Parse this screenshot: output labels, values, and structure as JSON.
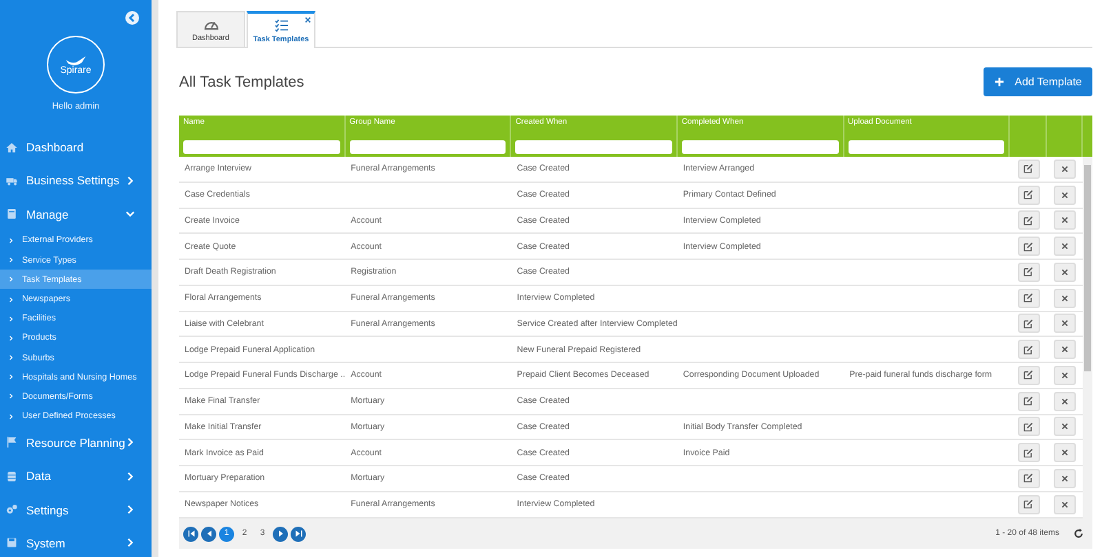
{
  "sidebar": {
    "logo": "Spirare",
    "greeting": "Hello admin",
    "items": [
      {
        "label": "Dashboard"
      },
      {
        "label": "Business Settings",
        "expanded": false
      },
      {
        "label": "Manage",
        "expanded": true,
        "children": [
          {
            "label": "External Providers",
            "selected": false
          },
          {
            "label": "Service Types",
            "selected": false
          },
          {
            "label": "Task Templates",
            "selected": true
          },
          {
            "label": "Newspapers",
            "selected": false
          },
          {
            "label": "Facilities",
            "selected": false
          },
          {
            "label": "Products",
            "selected": false
          },
          {
            "label": "Suburbs",
            "selected": false
          },
          {
            "label": "Hospitals and Nursing Homes",
            "selected": false
          },
          {
            "label": "Documents/Forms",
            "selected": false
          },
          {
            "label": "User Defined Processes",
            "selected": false
          }
        ]
      },
      {
        "label": "Resource Planning",
        "expanded": false
      },
      {
        "label": "Data",
        "expanded": false
      },
      {
        "label": "Settings",
        "expanded": false
      },
      {
        "label": "System",
        "expanded": false
      }
    ]
  },
  "tabs": [
    {
      "label": "Dashboard",
      "selected": false
    },
    {
      "label": "Task Templates",
      "selected": true
    }
  ],
  "page_title": "All Task Templates",
  "add_button": "Add Template",
  "table": {
    "columns": [
      "Name",
      "Group Name",
      "Created When",
      "Completed When",
      "Upload Document"
    ],
    "rows": [
      {
        "name": "Arrange Interview",
        "group": "Funeral Arrangements",
        "created": "Case Created",
        "completed": "Interview Arranged"
      },
      {
        "name": "Case Credentials",
        "created": "Case Created",
        "completed": "Primary Contact Defined"
      },
      {
        "name": "Create Invoice",
        "group": "Account",
        "created": "Case Created",
        "completed": "Interview Completed"
      },
      {
        "name": "Create Quote",
        "group": "Account",
        "created": "Case Created",
        "completed": "Interview Completed"
      },
      {
        "name": "Draft Death Registration",
        "group": "Registration",
        "created": "Case Created"
      },
      {
        "name": "Floral Arrangements",
        "group": "Funeral Arrangements",
        "created": "Interview Completed"
      },
      {
        "name": "Liaise with Celebrant",
        "group": "Funeral Arrangements",
        "created": "Service Created after Interview Completed"
      },
      {
        "name": "Lodge Prepaid Funeral Application",
        "created": "New Funeral Prepaid Registered"
      },
      {
        "name": "Lodge Prepaid Funeral Funds Discharge ...",
        "group": "Account",
        "created": "Prepaid Client Becomes Deceased",
        "completed": "Corresponding Document Uploaded",
        "upload": "Pre-paid funeral funds discharge form"
      },
      {
        "name": "Make Final Transfer",
        "group": "Mortuary",
        "created": "Case Created"
      },
      {
        "name": "Make Initial Transfer",
        "group": "Mortuary",
        "created": "Case Created",
        "completed": "Initial Body Transfer Completed"
      },
      {
        "name": "Mark Invoice as Paid",
        "group": "Account",
        "created": "Case Created",
        "completed": "Invoice Paid"
      },
      {
        "name": "Mortuary Preparation",
        "group": "Mortuary",
        "created": "Case Created"
      },
      {
        "name": "Newspaper Notices",
        "group": "Funeral Arrangements",
        "created": "Interview Completed"
      }
    ]
  },
  "pager": {
    "pages": [
      {
        "label": "1",
        "selected": true
      },
      {
        "label": "2",
        "selected": false
      },
      {
        "label": "3",
        "selected": false
      }
    ],
    "summary": "1 - 20 of 48 items"
  }
}
